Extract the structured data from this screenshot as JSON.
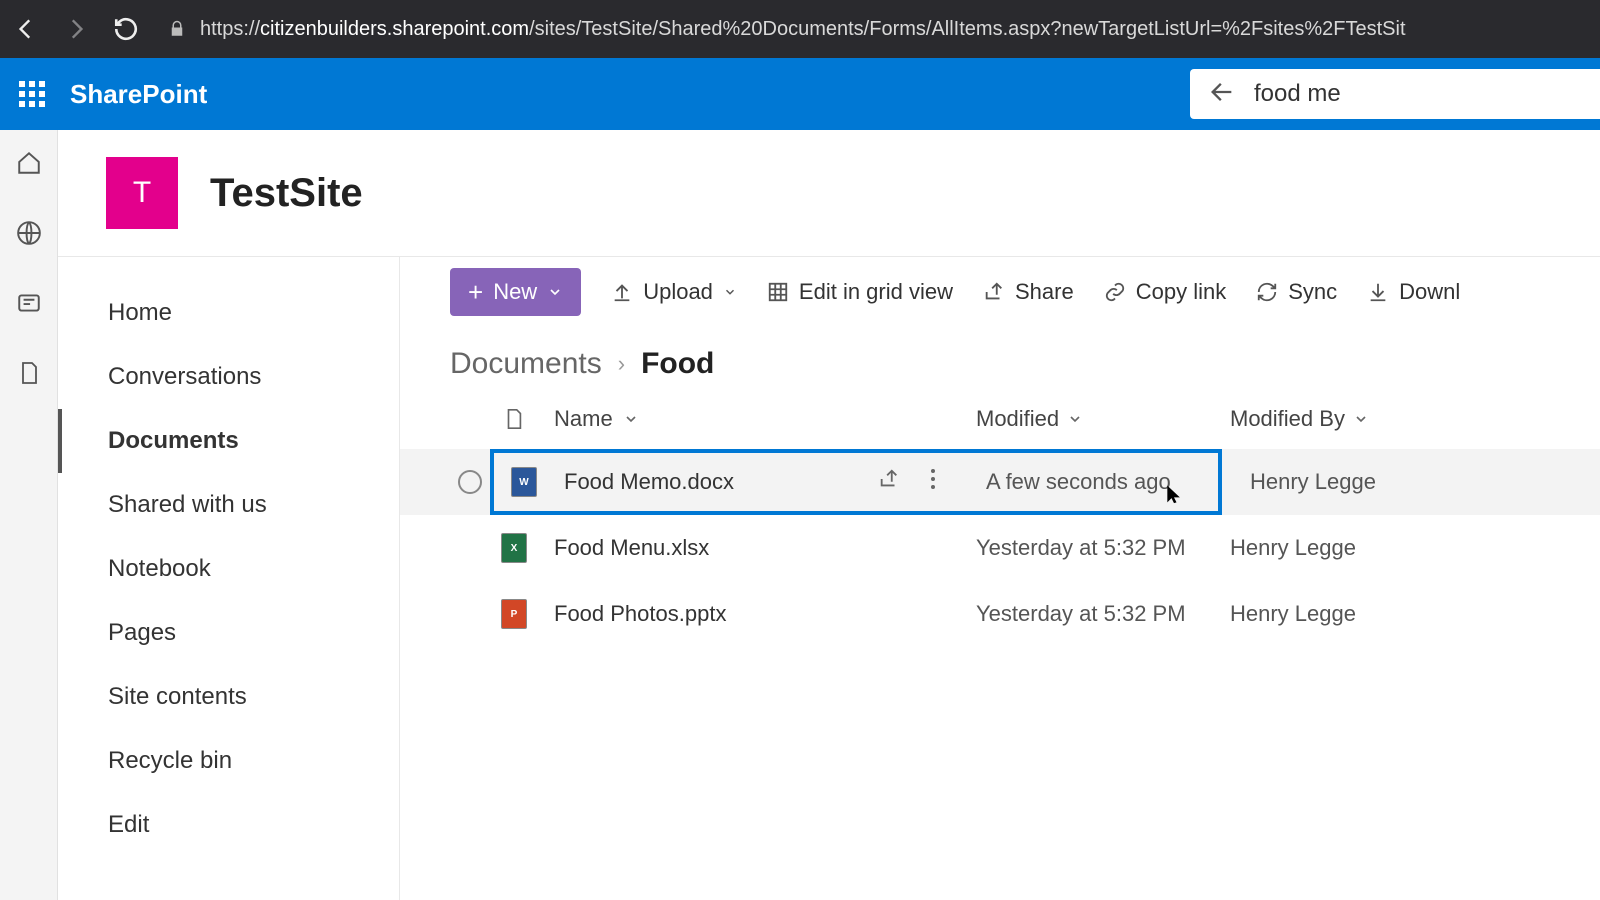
{
  "browser": {
    "url_prefix": "https://",
    "url_host": "citizenbuilders.sharepoint.com",
    "url_path": "/sites/TestSite/Shared%20Documents/Forms/AllItems.aspx?newTargetListUrl=%2Fsites%2FTestSit"
  },
  "suite": {
    "product": "SharePoint",
    "search_value": "food me"
  },
  "site": {
    "logo_letter": "T",
    "title": "TestSite"
  },
  "nav": {
    "items": [
      "Home",
      "Conversations",
      "Documents",
      "Shared with us",
      "Notebook",
      "Pages",
      "Site contents",
      "Recycle bin",
      "Edit"
    ],
    "active_index": 2
  },
  "commands": {
    "new": "New",
    "upload": "Upload",
    "edit_grid": "Edit in grid view",
    "share": "Share",
    "copy_link": "Copy link",
    "sync": "Sync",
    "download": "Downl"
  },
  "breadcrumb": {
    "root": "Documents",
    "current": "Food"
  },
  "columns": {
    "name": "Name",
    "modified": "Modified",
    "modified_by": "Modified By"
  },
  "files": [
    {
      "name": "Food Memo.docx",
      "type": "word",
      "modified": "A few seconds ago",
      "by": "Henry Legge",
      "selected": true
    },
    {
      "name": "Food Menu.xlsx",
      "type": "xls",
      "modified": "Yesterday at 5:32 PM",
      "by": "Henry Legge",
      "selected": false
    },
    {
      "name": "Food Photos.pptx",
      "type": "ppt",
      "modified": "Yesterday at 5:32 PM",
      "by": "Henry Legge",
      "selected": false
    }
  ]
}
